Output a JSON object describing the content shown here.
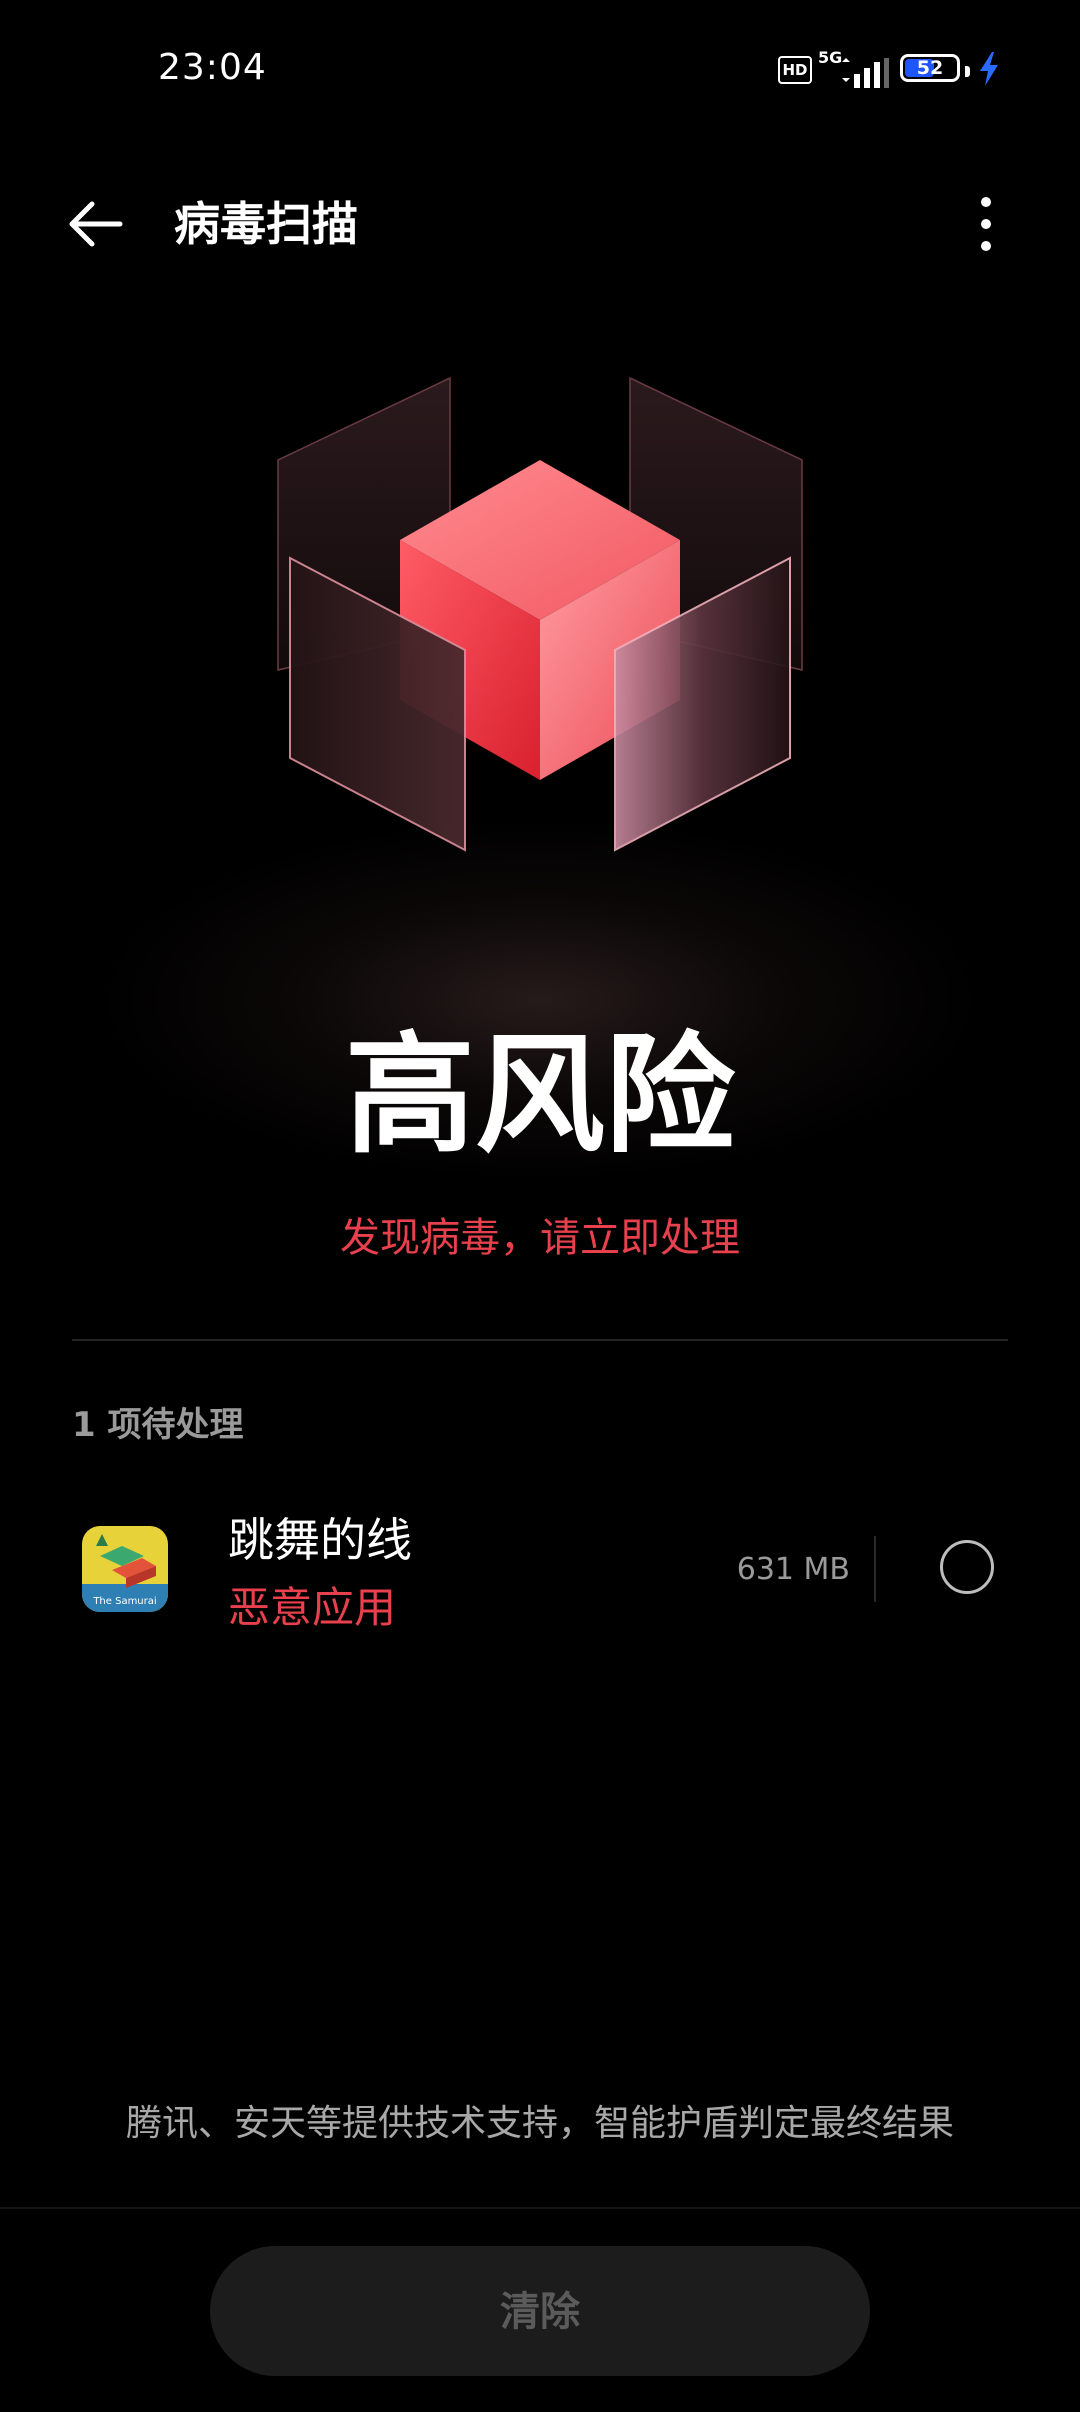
{
  "status_bar": {
    "time": "23:04",
    "hd_label": "HD",
    "network_label": "5G",
    "battery_level": "52",
    "charging_icon": "bolt-icon"
  },
  "header": {
    "title": "病毒扫描",
    "back_icon": "arrow-left-icon",
    "more_icon": "more-vertical-icon"
  },
  "result": {
    "risk_level": "高风险",
    "message": "发现病毒，请立即处理"
  },
  "pending": {
    "count_label": "1 项待处理",
    "items": [
      {
        "name": "跳舞的线",
        "risk_tag": "恶意应用",
        "size": "631 MB",
        "icon_caption": "The Samurai",
        "selected": false
      }
    ]
  },
  "footer": {
    "support_text": "腾讯、安天等提供技术支持，智能护盾判定最终结果",
    "clear_button": "清除"
  },
  "colors": {
    "background": "#000000",
    "danger": "#e8414d",
    "secondary_text": "#9a9a9a",
    "button_bg": "#1c1c1c",
    "battery_fill": "#1f55ff"
  }
}
